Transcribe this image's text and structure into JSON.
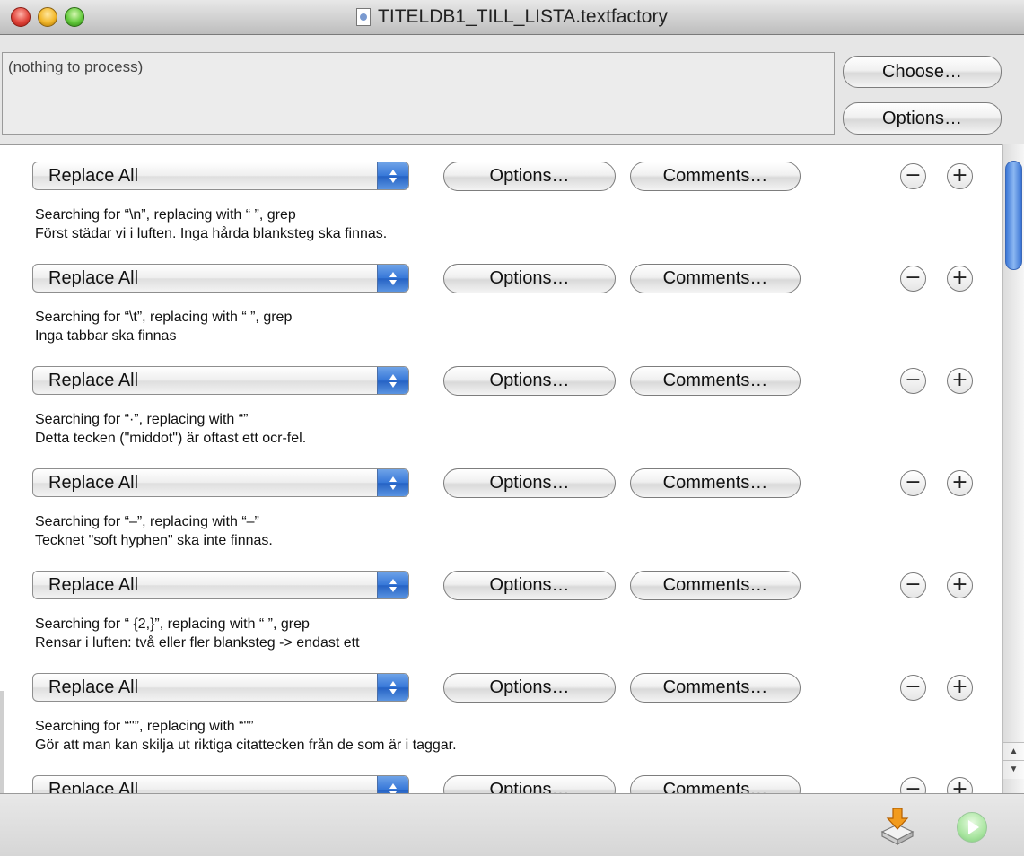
{
  "window": {
    "title": "TITELDB1_TILL_LISTA.textfactory"
  },
  "input": {
    "status": "(nothing to process)"
  },
  "top_buttons": {
    "choose": "Choose…",
    "options": "Options…"
  },
  "actions": [
    {
      "type": "Replace All",
      "options_label": "Options…",
      "comments_label": "Comments…",
      "summary": "Searching for “\\n”, replacing with “ ”, grep",
      "comment": "Först städar vi i luften. Inga hårda blanksteg ska finnas."
    },
    {
      "type": "Replace All",
      "options_label": "Options…",
      "comments_label": "Comments…",
      "summary": "Searching for “\\t”, replacing with “ ”, grep",
      "comment": "Inga tabbar ska finnas"
    },
    {
      "type": "Replace All",
      "options_label": "Options…",
      "comments_label": "Comments…",
      "summary": "Searching for “·”, replacing with “”",
      "comment": "Detta tecken (\"middot\") är oftast ett ocr-fel."
    },
    {
      "type": "Replace All",
      "options_label": "Options…",
      "comments_label": "Comments…",
      "summary": "Searching for “–”, replacing with “–”",
      "comment": "Tecknet \"soft hyphen\" ska inte finnas."
    },
    {
      "type": "Replace All",
      "options_label": "Options…",
      "comments_label": "Comments…",
      "summary": "Searching for “ {2,}”, replacing with “ ”, grep",
      "comment": "Rensar i luften: två eller fler blanksteg -> endast ett"
    },
    {
      "type": "Replace All",
      "options_label": "Options…",
      "comments_label": "Comments…",
      "summary": "Searching for “\"”, replacing with “\"”",
      "comment": "Gör att man kan skilja ut riktiga citattecken från de som är i taggar."
    },
    {
      "type": "Replace All",
      "options_label": "Options…",
      "comments_label": "Comments…",
      "summary": "",
      "comment": ""
    }
  ],
  "row_controls": {
    "minus": "−",
    "plus": "+"
  },
  "scrollbar": {
    "up_arrow": "▲",
    "down_arrow": "▼"
  },
  "icons": {
    "save": "save-tray-icon",
    "run": "run-play-icon"
  }
}
